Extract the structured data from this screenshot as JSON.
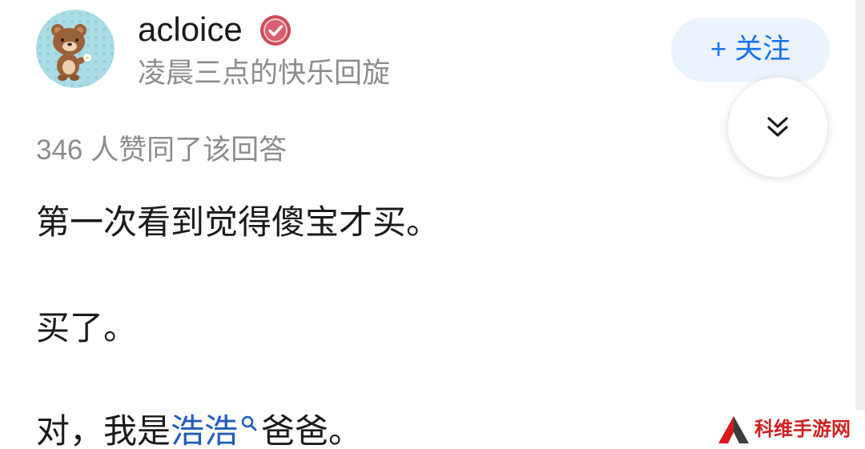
{
  "author": {
    "name": "acloice",
    "bio": "凌晨三点的快乐回旋",
    "avatar_icon": "bear-avatar-icon",
    "badge_icon": "verified-badge-icon"
  },
  "follow_button": {
    "label": "+ 关注"
  },
  "expand_button": {
    "icon": "double-chevron-down-icon"
  },
  "votes": "346 人赞同了该回答",
  "answer": {
    "paragraph_1": "第一次看到觉得傻宝才买。",
    "paragraph_2": "买了。",
    "paragraph_3": {
      "before": "对，我是",
      "link": "浩浩",
      "link_icon": "search-icon",
      "after": "爸爸。"
    }
  },
  "watermark": {
    "logo_icon": "triangle-logo-icon",
    "text": "科维手游网"
  },
  "colors": {
    "text": "#1a1a1a",
    "muted": "#8c8c8c",
    "link": "#1f5cbf",
    "accent": "#1772f6",
    "follow_bg": "#ebf3fd",
    "watermark": "#d41f1f"
  }
}
